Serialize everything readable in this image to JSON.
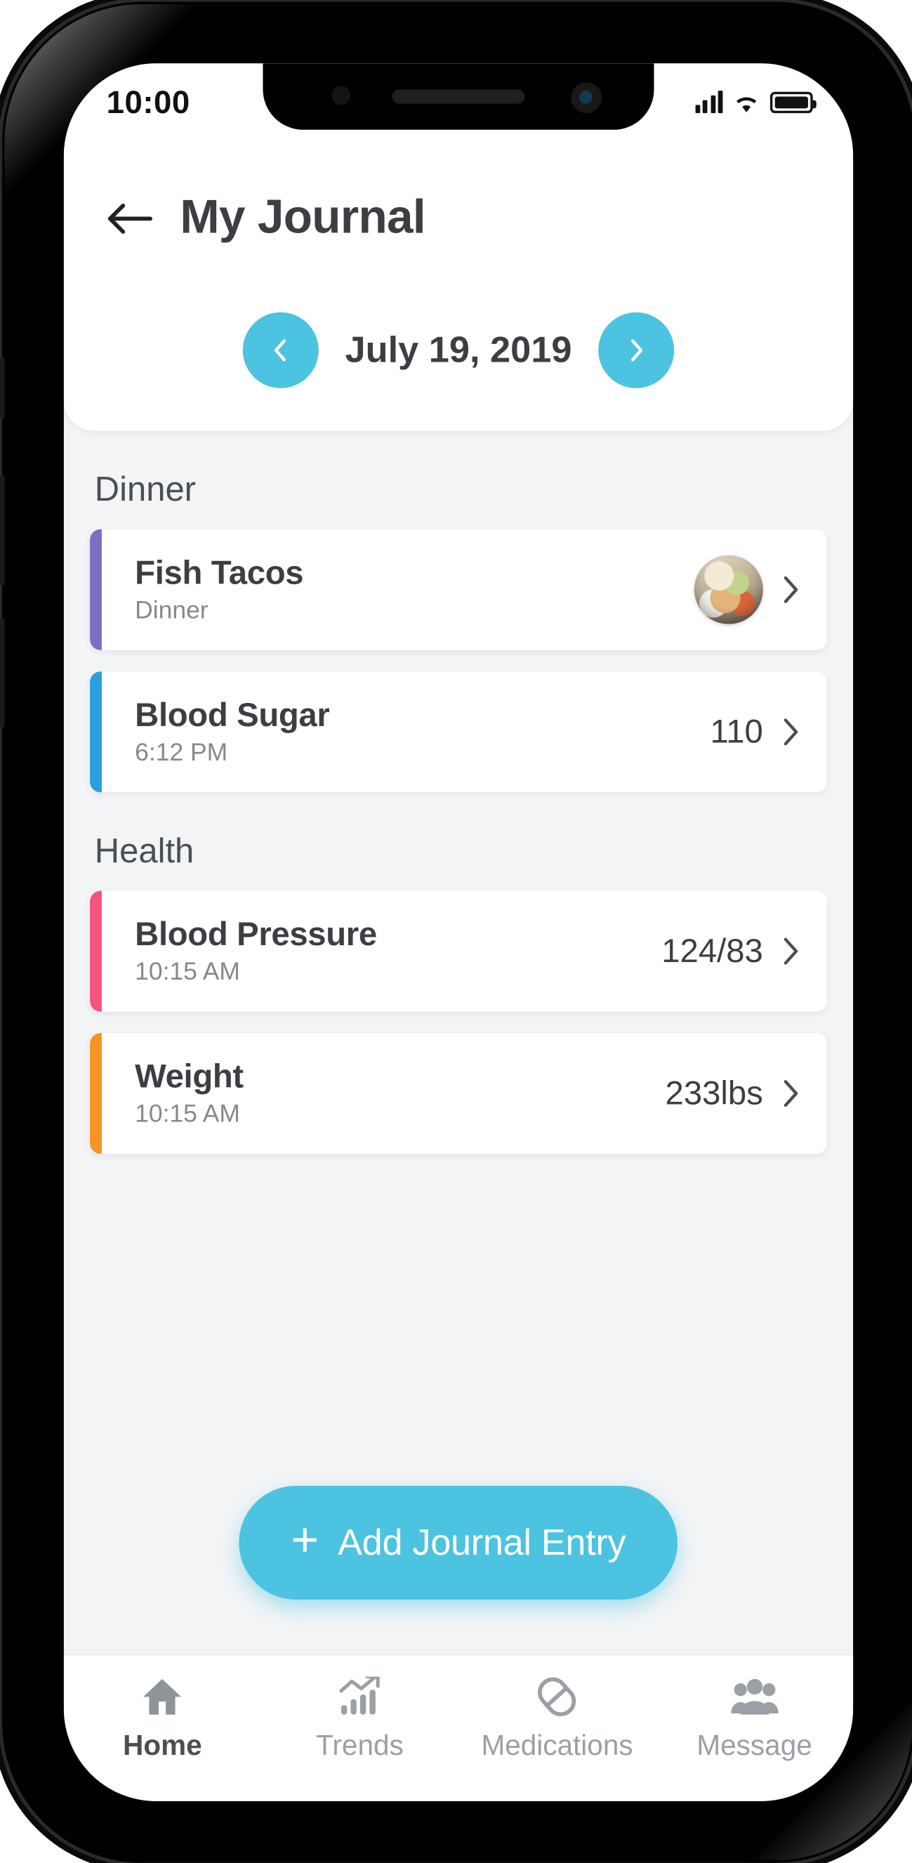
{
  "status_bar": {
    "time": "10:00",
    "signal_icon": "cellular-signal-icon",
    "wifi_icon": "wifi-icon",
    "battery_icon": "battery-full-icon"
  },
  "header": {
    "back_icon": "back-arrow-icon",
    "title": "My Journal"
  },
  "date_nav": {
    "prev_icon": "chevron-left-icon",
    "next_icon": "chevron-right-icon",
    "date": "July 19, 2019"
  },
  "sections": [
    {
      "title": "Dinner",
      "entries": [
        {
          "title": "Fish Tacos",
          "subtitle": "Dinner",
          "value": "",
          "accent_color": "#7b6fc4",
          "thumbnail": "food-photo-thumbnail",
          "chevron_icon": "chevron-right-icon"
        },
        {
          "title": "Blood Sugar",
          "subtitle": "6:12 PM",
          "value": "110",
          "accent_color": "#2a9fe0",
          "thumbnail": "",
          "chevron_icon": "chevron-right-icon"
        }
      ]
    },
    {
      "title": "Health",
      "entries": [
        {
          "title": "Blood Pressure",
          "subtitle": "10:15 AM",
          "value": "124/83",
          "accent_color": "#f4547f",
          "thumbnail": "",
          "chevron_icon": "chevron-right-icon"
        },
        {
          "title": "Weight",
          "subtitle": "10:15 AM",
          "value": "233lbs",
          "accent_color": "#f59425",
          "thumbnail": "",
          "chevron_icon": "chevron-right-icon"
        }
      ]
    }
  ],
  "fab": {
    "plus": "+",
    "label": "Add Journal Entry",
    "color": "#4cc3e0"
  },
  "tab_bar": {
    "items": [
      {
        "label": "Home",
        "icon": "home-icon",
        "active": true
      },
      {
        "label": "Trends",
        "icon": "trends-chart-icon",
        "active": false
      },
      {
        "label": "Medications",
        "icon": "pill-icon",
        "active": false
      },
      {
        "label": "Message",
        "icon": "people-icon",
        "active": false
      }
    ]
  },
  "theme": {
    "accent": "#4cc3e0",
    "background": "#f2f4f6",
    "card": "#ffffff",
    "text": "#3b3f43",
    "muted": "#85898d"
  }
}
